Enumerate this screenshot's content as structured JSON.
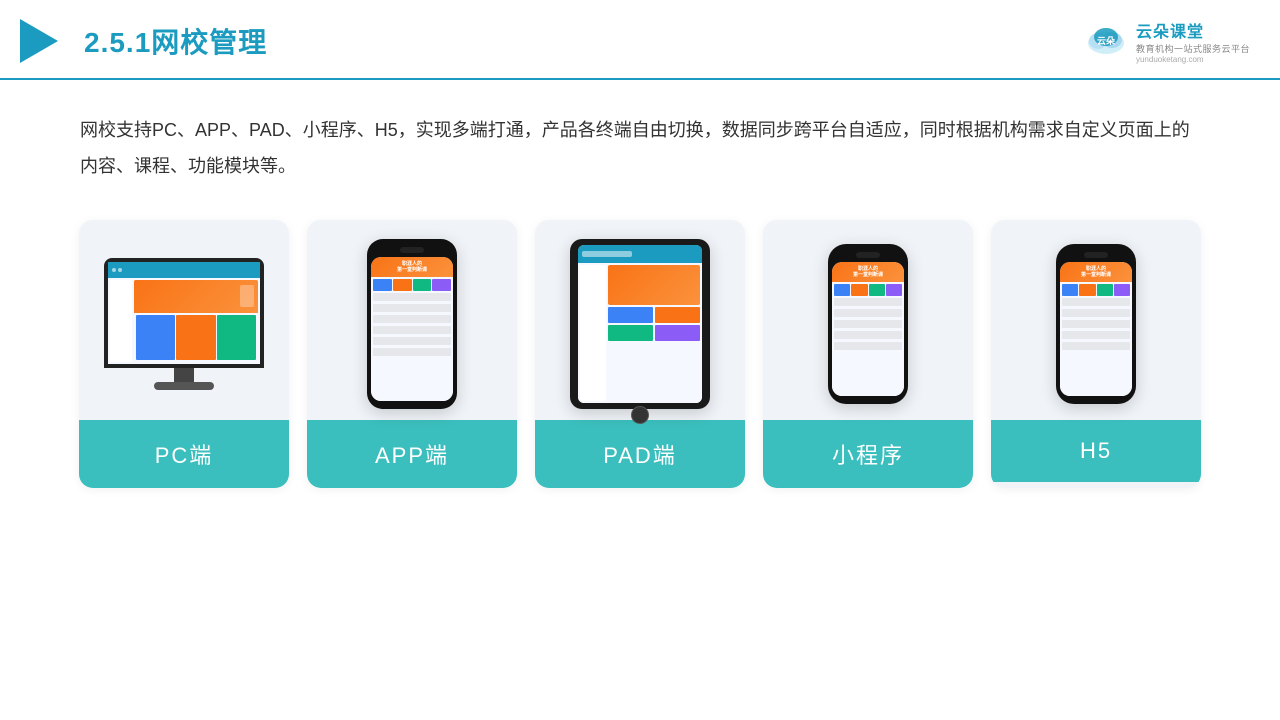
{
  "header": {
    "title_prefix": "2.5.1",
    "title_main": "网校管理",
    "logo_main": "云朵课堂",
    "logo_url": "yunduoketang.com",
    "logo_tagline": "教育机构一站式服务云平台"
  },
  "description": {
    "text": "网校支持PC、APP、PAD、小程序、H5，实现多端打通，产品各终端自由切换，数据同步跨平台自适应，同时根据机构需求自定义页面上的内容、课程、功能模块等。"
  },
  "cards": [
    {
      "id": "pc",
      "label": "PC端"
    },
    {
      "id": "app",
      "label": "APP端"
    },
    {
      "id": "pad",
      "label": "PAD端"
    },
    {
      "id": "mini",
      "label": "小程序"
    },
    {
      "id": "h5",
      "label": "H5"
    }
  ],
  "colors": {
    "accent": "#1a9bbf",
    "teal": "#3bbfbe",
    "orange": "#f97316",
    "bg_card": "#f0f4f8"
  }
}
